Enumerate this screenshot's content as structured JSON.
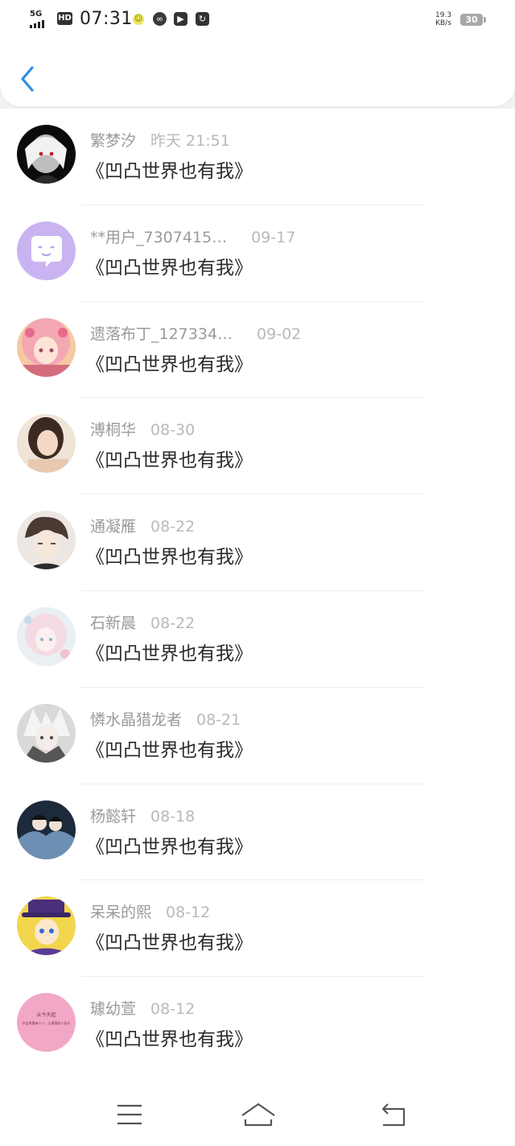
{
  "status_bar": {
    "network": "5G",
    "hd": "HD",
    "time": "07:31",
    "speed_value": "19.3",
    "speed_unit": "KB/s",
    "battery": "30",
    "icons": [
      "weather-smile-icon",
      "link-icon",
      "play-icon",
      "refresh-icon"
    ]
  },
  "header": {
    "back_icon": "chevron-left-icon"
  },
  "colors": {
    "accent": "#2d8fe5",
    "name_text": "#9a9a9a",
    "date_text": "#b9b9b9",
    "title_text": "#2a2a2a",
    "background": "#f2f2f2"
  },
  "messages": [
    {
      "name": "繁梦汐",
      "date": "昨天  21:51",
      "title": "《凹凸世界也有我》",
      "avatar": "dark-anime-avatar"
    },
    {
      "name": "**用户_7307415…",
      "date": "09-17",
      "title": "《凹凸世界也有我》",
      "avatar": "default-chat-bubble-avatar"
    },
    {
      "name": "遗落布丁_127334…",
      "date": "09-02",
      "title": "《凹凸世界也有我》",
      "avatar": "pink-hair-anime-avatar"
    },
    {
      "name": "溥桐华",
      "date": "08-30",
      "title": "《凹凸世界也有我》",
      "avatar": "portrait-photo-avatar"
    },
    {
      "name": "通凝雁",
      "date": "08-22",
      "title": "《凹凸世界也有我》",
      "avatar": "anime-boy-avatar"
    },
    {
      "name": "石新晨",
      "date": "08-22",
      "title": "《凹凸世界也有我》",
      "avatar": "pastel-anime-avatar"
    },
    {
      "name": "憐水晶猎龙者",
      "date": "08-21",
      "title": "《凹凸世界也有我》",
      "avatar": "silver-anime-avatar"
    },
    {
      "name": "杨懿轩",
      "date": "08-18",
      "title": "《凹凸世界也有我》",
      "avatar": "dark-fantasy-avatar"
    },
    {
      "name": "呆呆的熙",
      "date": "08-12",
      "title": "《凹凸世界也有我》",
      "avatar": "purple-hat-anime-avatar"
    },
    {
      "name": "璩幼萱",
      "date": "08-12",
      "title": "《凹凸世界也有我》",
      "avatar": "pink-text-avatar",
      "avatar_text": "从今天起",
      "avatar_subtext": "学会将重每个人，让周围的人快乐"
    }
  ],
  "nav_bar": {
    "menu_icon": "menu-icon",
    "home_icon": "home-icon",
    "back_icon": "back-arrow-icon"
  }
}
